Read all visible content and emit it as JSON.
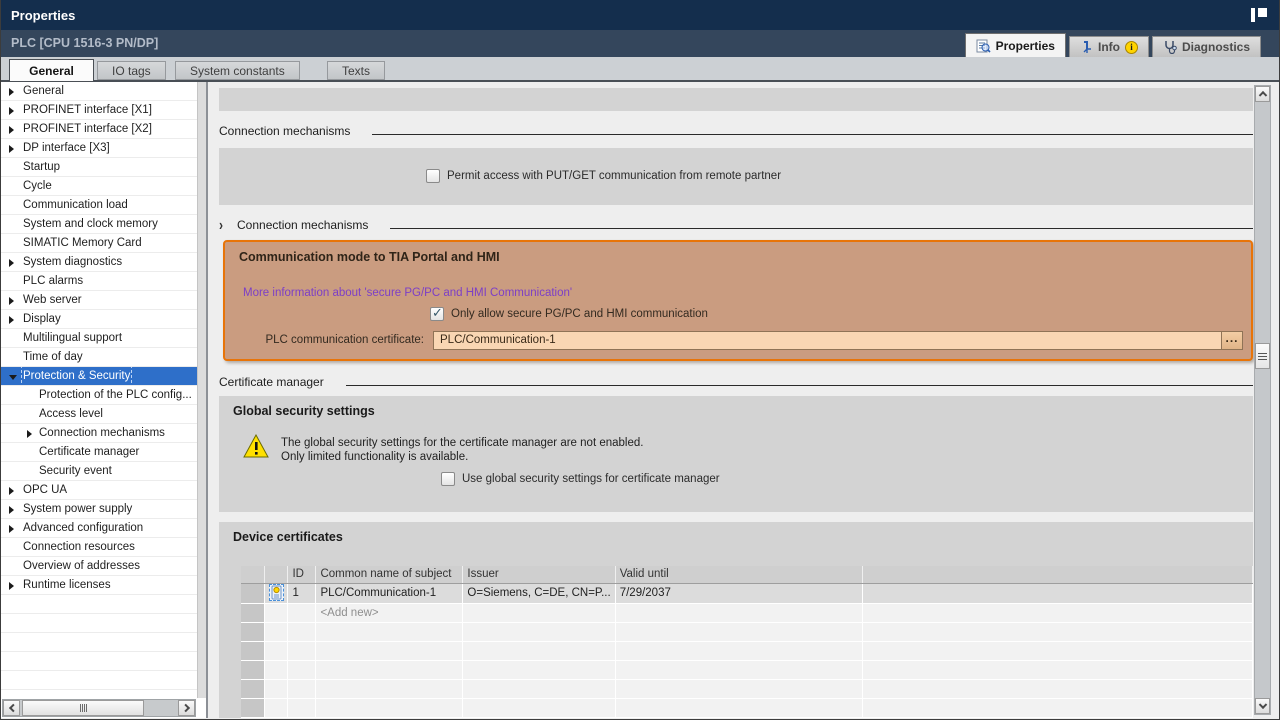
{
  "window": {
    "title": "Properties"
  },
  "header": {
    "device_title": "PLC [CPU 1516-3 PN/DP]",
    "tabs": [
      {
        "label": "Properties",
        "icon": "properties-icon",
        "selected": true
      },
      {
        "label": "Info",
        "icon": "info-icon",
        "badge": "i",
        "selected": false
      },
      {
        "label": "Diagnostics",
        "icon": "diagnostics-icon",
        "selected": false
      }
    ]
  },
  "tabstrip": {
    "tabs": [
      {
        "label": "General",
        "selected": true
      },
      {
        "label": "IO tags",
        "selected": false
      },
      {
        "label": "System constants",
        "selected": false
      },
      {
        "label": "Texts",
        "selected": false
      }
    ]
  },
  "tree": {
    "items": [
      {
        "label": "General",
        "level": 0,
        "arrow": "collapsed"
      },
      {
        "label": "PROFINET interface [X1]",
        "level": 0,
        "arrow": "collapsed"
      },
      {
        "label": "PROFINET interface [X2]",
        "level": 0,
        "arrow": "collapsed"
      },
      {
        "label": "DP interface [X3]",
        "level": 0,
        "arrow": "collapsed"
      },
      {
        "label": "Startup",
        "level": 0
      },
      {
        "label": "Cycle",
        "level": 0
      },
      {
        "label": "Communication load",
        "level": 0
      },
      {
        "label": "System and clock memory",
        "level": 0
      },
      {
        "label": "SIMATIC Memory Card",
        "level": 0
      },
      {
        "label": "System diagnostics",
        "level": 0,
        "arrow": "collapsed"
      },
      {
        "label": "PLC alarms",
        "level": 0
      },
      {
        "label": "Web server",
        "level": 0,
        "arrow": "collapsed"
      },
      {
        "label": "Display",
        "level": 0,
        "arrow": "collapsed"
      },
      {
        "label": "Multilingual support",
        "level": 0
      },
      {
        "label": "Time of day",
        "level": 0
      },
      {
        "label": "Protection & Security",
        "level": 0,
        "arrow": "expanded",
        "selected": true,
        "marker": "left"
      },
      {
        "label": "Protection of the PLC config...",
        "level": 1
      },
      {
        "label": "Access level",
        "level": 1,
        "marker": "right"
      },
      {
        "label": "Connection mechanisms",
        "level": 1,
        "arrow": "collapsed"
      },
      {
        "label": "Certificate manager",
        "level": 1
      },
      {
        "label": "Security event",
        "level": 1
      },
      {
        "label": "OPC UA",
        "level": 0,
        "arrow": "collapsed"
      },
      {
        "label": "System power supply",
        "level": 0,
        "arrow": "collapsed"
      },
      {
        "label": "Advanced configuration",
        "level": 0,
        "arrow": "collapsed"
      },
      {
        "label": "Connection resources",
        "level": 0
      },
      {
        "label": "Overview of addresses",
        "level": 0
      },
      {
        "label": "Runtime licenses",
        "level": 0,
        "arrow": "collapsed"
      }
    ]
  },
  "main": {
    "section_connection": {
      "title": "Connection mechanisms"
    },
    "putget_checkbox": {
      "label": "Permit access with PUT/GET communication from remote partner",
      "checked": false
    },
    "section_connection2": {
      "title": "Connection mechanisms",
      "chevron": "›"
    },
    "secure_box": {
      "title": "Communication mode to TIA Portal and HMI",
      "link": "More information about 'secure PG/PC and HMI Communication'",
      "checkbox": {
        "label": "Only allow secure PG/PC and HMI communication",
        "checked": true
      },
      "cert_field": {
        "label": "PLC communication certificate:",
        "value": "PLC/Communication-1",
        "browse_label": "..."
      }
    },
    "section_certmgr": {
      "title": "Certificate manager"
    },
    "global_box": {
      "title": "Global security settings",
      "warning_line1": "The global security settings for the certificate manager are not enabled.",
      "warning_line2": "Only limited functionality is available.",
      "checkbox": {
        "label": "Use global security settings for certificate manager",
        "checked": false
      }
    },
    "device_box": {
      "title": "Device certificates",
      "table": {
        "columns": [
          "",
          "",
          "ID",
          "Common name of subject",
          "Issuer",
          "Valid until",
          ""
        ],
        "rows": [
          {
            "id": "1",
            "common_name": "PLC/Communication-1",
            "issuer": "O=Siemens, C=DE, CN=P...",
            "valid_until": "7/29/2037"
          }
        ],
        "add_row_label": "<Add new>",
        "empty_rows": 5
      }
    }
  },
  "colors": {
    "titlebar": "#142e4d",
    "subheader": "#34465c",
    "selection_blue": "#2e6fc9",
    "accent_orange_border": "#e87408",
    "accent_orange_fill": "#ca9c80",
    "field_peach": "#f9d6b3",
    "link_purple": "#7c3fc6",
    "warning_yellow": "#ffe000",
    "box_gray": "#d3d3d3"
  }
}
